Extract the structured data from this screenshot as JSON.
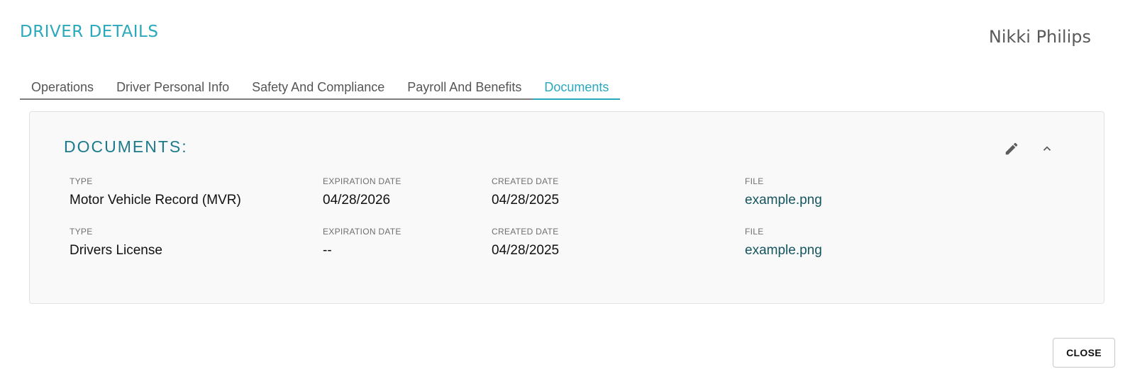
{
  "header": {
    "title": "DRIVER DETAILS",
    "driver_name": "Nikki Philips"
  },
  "tabs": [
    {
      "label": "Operations",
      "active": false
    },
    {
      "label": "Driver Personal Info",
      "active": false
    },
    {
      "label": "Safety And Compliance",
      "active": false
    },
    {
      "label": "Payroll And Benefits",
      "active": false
    },
    {
      "label": "Documents",
      "active": true
    }
  ],
  "documents": {
    "section_title": "DOCUMENTS:",
    "edit_icon": "pencil-icon",
    "collapse_icon": "chevron-up-icon",
    "labels": {
      "type": "TYPE",
      "expiration": "EXPIRATION DATE",
      "created": "CREATED DATE",
      "file": "FILE"
    },
    "rows": [
      {
        "type": "Motor Vehicle Record (MVR)",
        "expiration": "04/28/2026",
        "created": "04/28/2025",
        "file": "example.png"
      },
      {
        "type": "Drivers License",
        "expiration": "--",
        "created": "04/28/2025",
        "file": "example.png"
      }
    ]
  },
  "footer": {
    "close_label": "CLOSE"
  },
  "colors": {
    "accent": "#2aa8bd",
    "section_title": "#1d7a8c",
    "link": "#14555f"
  }
}
